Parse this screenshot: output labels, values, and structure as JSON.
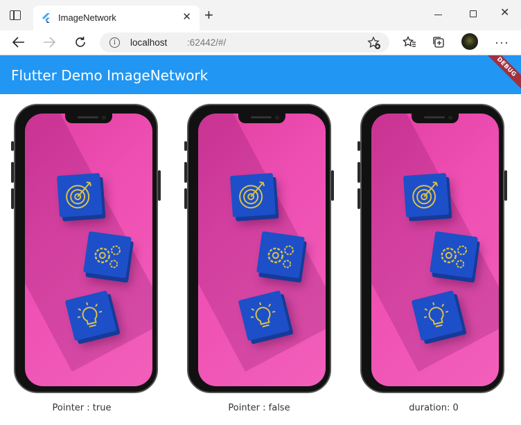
{
  "browser": {
    "tab_title": "ImageNetwork",
    "url_host": "localhost",
    "url_path": ":62442/#/"
  },
  "app": {
    "title": "Flutter Demo ImageNetwork",
    "debug_label": "DEBUG",
    "accent_color": "#2196f3"
  },
  "phones": [
    {
      "caption": "Pointer : true"
    },
    {
      "caption": "Pointer : false"
    },
    {
      "caption": "duration: 0"
    }
  ]
}
